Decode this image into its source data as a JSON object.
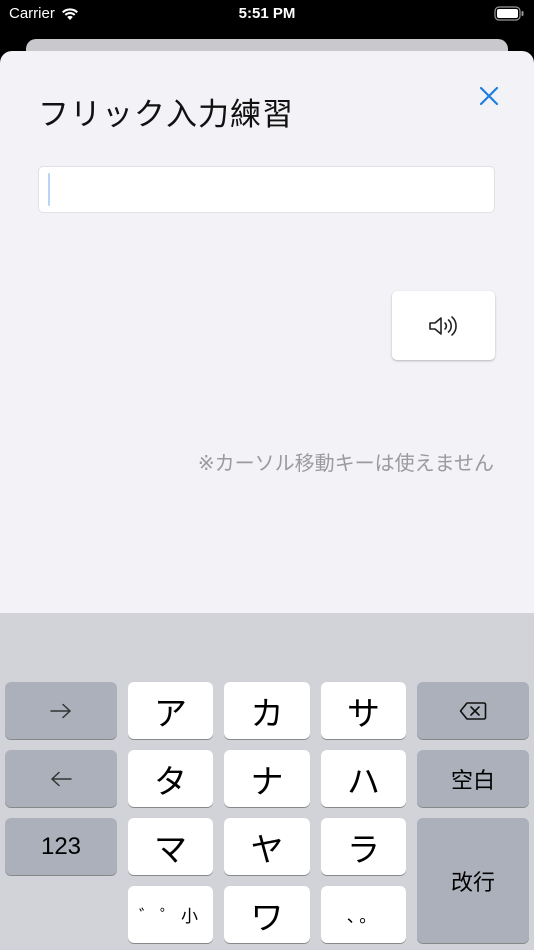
{
  "status_bar": {
    "carrier": "Carrier",
    "time": "5:51 PM"
  },
  "sheet": {
    "title": "フリック入力練習",
    "input_value": "",
    "note": "※カーソル移動キーは使えません"
  },
  "keyboard": {
    "keys": {
      "row1_fn": "→",
      "a": "ア",
      "ka": "カ",
      "sa": "サ",
      "row2_fn": "←",
      "ta": "タ",
      "na": "ナ",
      "ha": "ハ",
      "space": "空白",
      "numbers": "123",
      "ma": "マ",
      "ya": "ヤ",
      "ra": "ラ",
      "return": "改行",
      "dakuten": "゛゜小",
      "wa": "ワ",
      "punct": "、。"
    }
  },
  "colors": {
    "accent": "#1e7ee0",
    "sheet_bg": "#f2f2f7",
    "keyboard_bg": "#d1d3d9",
    "fn_key": "#abb0ba"
  }
}
